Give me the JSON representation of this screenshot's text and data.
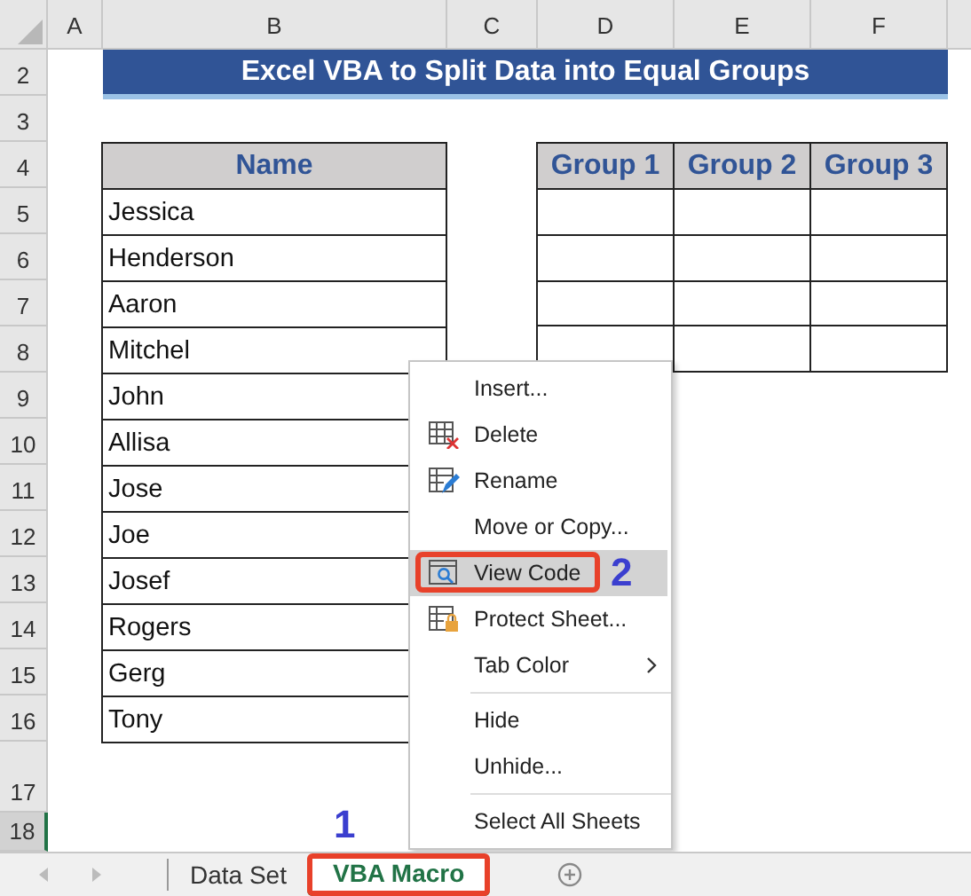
{
  "columns": [
    "A",
    "B",
    "C",
    "D",
    "E",
    "F"
  ],
  "rows": [
    "2",
    "3",
    "4",
    "5",
    "6",
    "7",
    "8",
    "9",
    "10",
    "11",
    "12",
    "13",
    "14",
    "15",
    "16",
    "17",
    "18"
  ],
  "title": "Excel VBA to Split Data into Equal Groups",
  "name_table": {
    "header": "Name",
    "rows": [
      "Jessica",
      "Henderson",
      "Aaron",
      "Mitchel",
      "John",
      "Allisa",
      "Jose",
      "Joe",
      "Josef",
      "Rogers",
      "Gerg",
      "Tony"
    ]
  },
  "group_table": {
    "headers": [
      "Group 1",
      "Group 2",
      "Group 3"
    ]
  },
  "sheet_tabs": [
    {
      "label": "Data Set",
      "selected": false
    },
    {
      "label": "VBA Macro",
      "selected": true
    }
  ],
  "context_menu": [
    {
      "label": "Insert...",
      "kind": "plain",
      "selected": false
    },
    {
      "label": "Delete",
      "kind": "delete",
      "selected": false
    },
    {
      "label": "Rename",
      "kind": "rename",
      "selected": false
    },
    {
      "label": "Move or Copy...",
      "kind": "plain",
      "selected": false
    },
    {
      "label": "View Code",
      "kind": "code",
      "selected": true
    },
    {
      "label": "Protect Sheet...",
      "kind": "protect",
      "selected": false
    },
    {
      "label": "Tab Color",
      "kind": "submenu",
      "selected": false
    },
    {
      "kind": "separator"
    },
    {
      "label": "Hide",
      "kind": "plain",
      "selected": false
    },
    {
      "label": "Unhide...",
      "kind": "plain",
      "selected": false
    },
    {
      "kind": "separator"
    },
    {
      "label": "Select All Sheets",
      "kind": "plain",
      "selected": false
    }
  ],
  "step_labels": [
    "1",
    "2"
  ]
}
